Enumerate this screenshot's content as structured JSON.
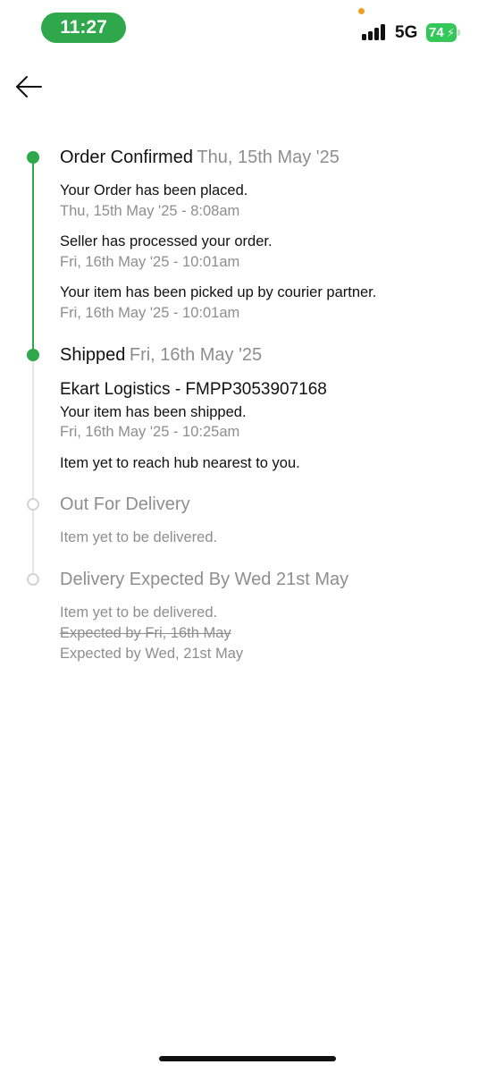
{
  "status_bar": {
    "time": "11:27",
    "network": "5G",
    "battery": "74",
    "signal_icon": "cellular-signal-icon",
    "colors": {
      "time_pill": "#2ea84a",
      "battery": "#34c759",
      "privacy_dot": "#f0a020"
    }
  },
  "nav": {
    "back_icon": "arrow-left-icon"
  },
  "colors": {
    "accent": "#2ea84a",
    "muted_text": "#8e8e8e",
    "inactive_node": "#d4d4d4"
  },
  "timeline": {
    "confirmed": {
      "title": "Order Confirmed",
      "date": "Thu, 15th May '25",
      "events": [
        {
          "text": "Your Order has been placed.",
          "time": "Thu, 15th May '25 - 8:08am"
        },
        {
          "text": "Seller has processed your order.",
          "time": "Fri, 16th May '25 - 10:01am"
        },
        {
          "text": "Your item has been picked up by courier partner.",
          "time": "Fri, 16th May '25 - 10:01am"
        }
      ]
    },
    "shipped": {
      "title": "Shipped",
      "date": "Fri, 16th May '25",
      "courier": "Ekart Logistics - FMPP3053907168",
      "events": [
        {
          "text": "Your item has been shipped.",
          "time": "Fri, 16th May '25 - 10:25am"
        }
      ],
      "note": "Item yet to reach hub nearest to you."
    },
    "out_for_delivery": {
      "title": "Out For Delivery",
      "note": "Item yet to be delivered."
    },
    "delivery": {
      "title": "Delivery Expected By Wed 21st May",
      "note": "Item yet to be delivered.",
      "old_expected": "Expected by Fri, 16th May",
      "new_expected": "Expected by Wed, 21st May"
    }
  }
}
